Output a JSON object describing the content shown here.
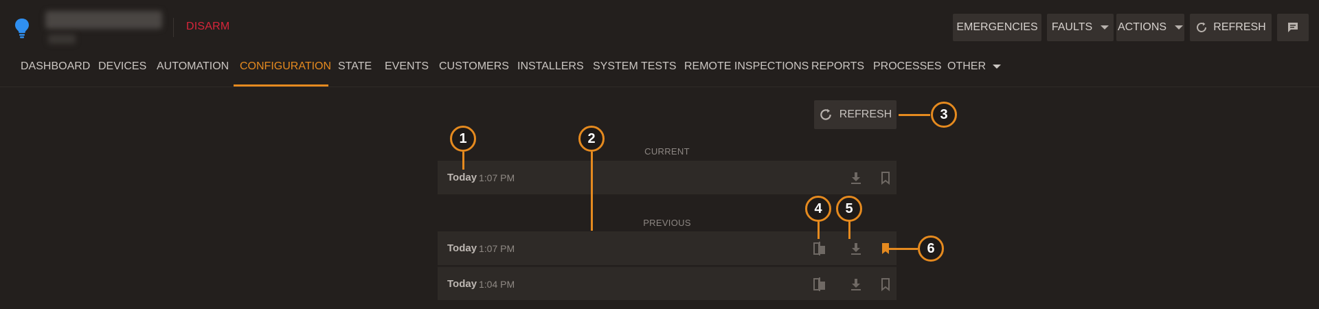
{
  "header": {
    "disarm_label": "DISARM",
    "buttons": {
      "emergencies": "EMERGENCIES",
      "faults": "FAULTS",
      "actions": "ACTIONS",
      "refresh": "REFRESH"
    }
  },
  "nav": {
    "items": [
      "DASHBOARD",
      "DEVICES",
      "AUTOMATION",
      "CONFIGURATION",
      "STATE",
      "EVENTS",
      "CUSTOMERS",
      "INSTALLERS",
      "SYSTEM TESTS",
      "REMOTE INSPECTIONS",
      "REPORTS",
      "PROCESSES",
      "OTHER"
    ],
    "active": "CONFIGURATION"
  },
  "main": {
    "refresh_label": "REFRESH",
    "current_label": "CURRENT",
    "previous_label": "PREVIOUS",
    "current_rows": [
      {
        "day": "Today",
        "time": "1:07 PM"
      }
    ],
    "previous_rows": [
      {
        "day": "Today",
        "time": "1:07 PM",
        "bookmarked": true
      },
      {
        "day": "Today",
        "time": "1:04 PM",
        "bookmarked": false
      }
    ]
  },
  "callouts": [
    "1",
    "2",
    "3",
    "4",
    "5",
    "6"
  ],
  "colors": {
    "accent": "#e58a1f",
    "danger": "#d8253a",
    "background": "#231f1d",
    "panel": "#2e2a27",
    "logo": "#2f8ff0"
  },
  "icons": [
    "lightbulb-icon",
    "refresh-icon",
    "chat-icon",
    "compare-icon",
    "download-icon",
    "bookmark-icon"
  ]
}
